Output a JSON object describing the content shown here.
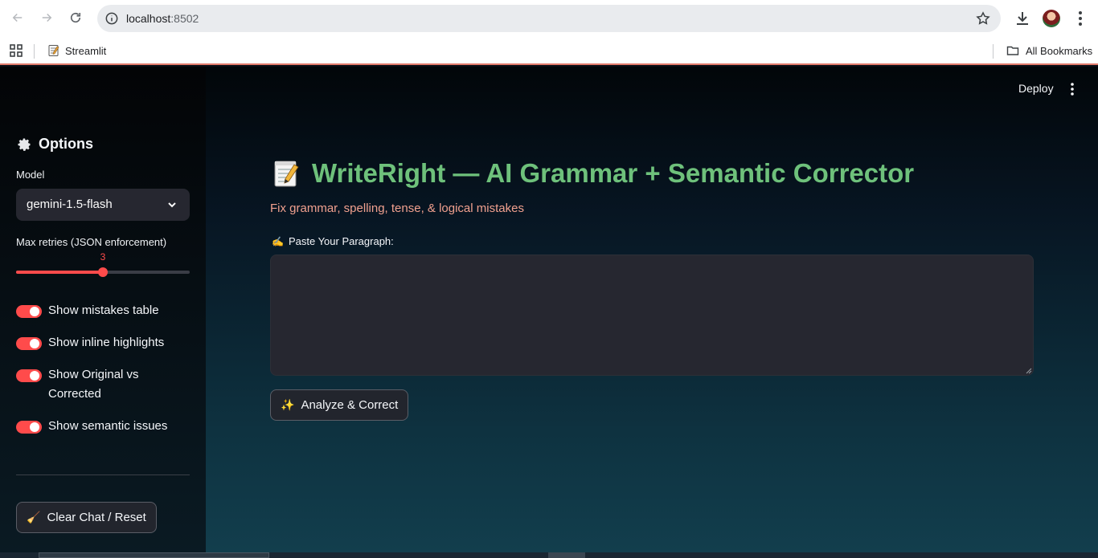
{
  "browser": {
    "url_host": "localhost",
    "url_port": ":8502",
    "bookmarks": [
      {
        "label": "Streamlit",
        "icon": "memo-page-icon"
      }
    ],
    "all_bookmarks_label": "All Bookmarks"
  },
  "app": {
    "toolbar": {
      "deploy_label": "Deploy"
    },
    "sidebar": {
      "title": "Options",
      "model_label": "Model",
      "model_value": "gemini-1.5-flash",
      "retries_label": "Max retries (JSON enforcement)",
      "retries_value": "3",
      "retries_fraction": 0.5,
      "toggles": [
        {
          "label": "Show mistakes table",
          "on": true
        },
        {
          "label": "Show inline highlights",
          "on": true
        },
        {
          "label": "Show Original vs Corrected",
          "on": true
        },
        {
          "label": "Show semantic issues",
          "on": true
        }
      ],
      "clear_button": {
        "emoji": "🧹",
        "label": "Clear Chat / Reset"
      }
    },
    "main": {
      "title_emoji": "📝",
      "title": "WriteRight — AI Grammar + Semantic Corrector",
      "subtitle": "Fix grammar, spelling, tense, & logical mistakes",
      "textarea_label_emoji": "✍️",
      "textarea_label": "Paste Your Paragraph:",
      "textarea_value": "",
      "analyze_button": {
        "emoji": "✨",
        "label": "Analyze & Correct"
      }
    }
  },
  "colors": {
    "accent": "#ff4b4b",
    "title_green": "#6ec17b",
    "subtitle_salmon": "#f0a08e",
    "input_bg": "#262730"
  }
}
